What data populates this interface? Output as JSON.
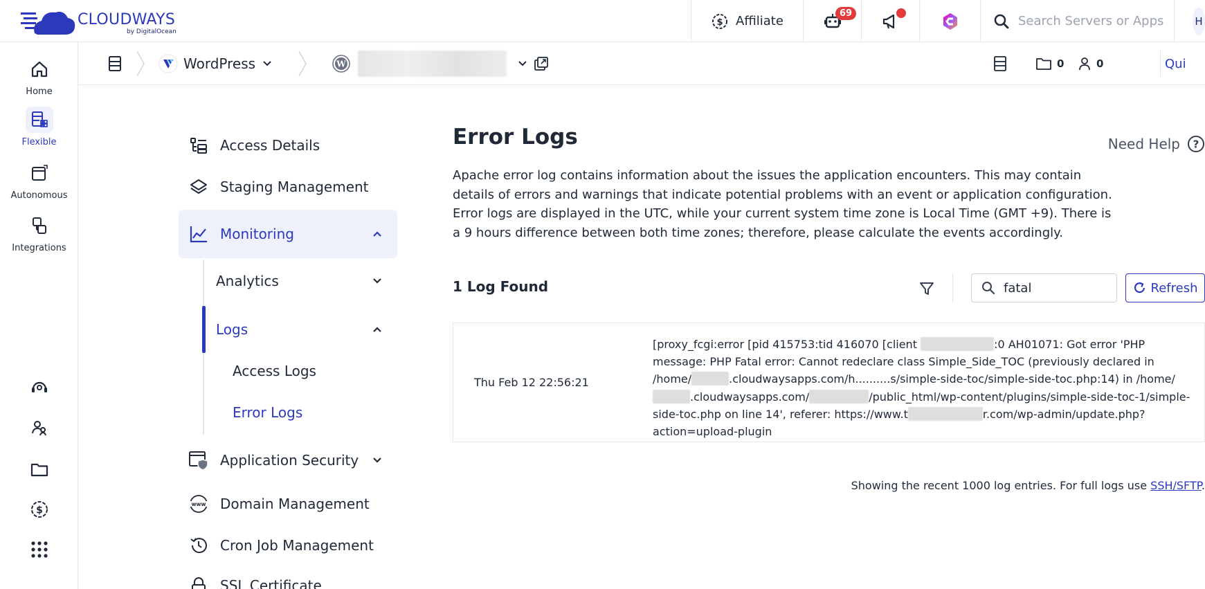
{
  "brand": {
    "name": "CLOUDWAYS",
    "sub": "by DigitalOcean",
    "accent": "#2c39bd",
    "badge_color": "#e23b3b"
  },
  "topbar": {
    "affiliate_label": "Affiliate",
    "bot_badge": "69",
    "search_placeholder": "Search Servers or Apps",
    "avatar_initial": "H"
  },
  "rail": {
    "items": [
      {
        "label": "Home",
        "icon": "home-icon"
      },
      {
        "label": "Flexible",
        "icon": "flexible-icon"
      },
      {
        "label": "Autonomous",
        "icon": "autonomous-icon"
      },
      {
        "label": "Integrations",
        "icon": "integrations-icon"
      }
    ],
    "bottom_icons": [
      "support-icon",
      "team-icon",
      "folder-icon",
      "billing-icon",
      "apps-grid-icon"
    ]
  },
  "breadcrumb": {
    "app_type": "WordPress",
    "stats": {
      "projects": "0",
      "members": "0"
    },
    "quick_label": "Qui"
  },
  "sidenav": {
    "items": [
      {
        "label": "Access Details"
      },
      {
        "label": "Staging Management"
      },
      {
        "label": "Monitoring"
      },
      {
        "label": "Analytics"
      },
      {
        "label": "Logs"
      },
      {
        "label": "Access Logs"
      },
      {
        "label": "Error Logs"
      },
      {
        "label": "Application Security"
      },
      {
        "label": "Domain Management"
      },
      {
        "label": "Cron Job Management"
      },
      {
        "label": "SSL Certificate"
      }
    ]
  },
  "main": {
    "title": "Error Logs",
    "need_help": "Need Help",
    "desc_1": "Apache error log contains information about the issues the application encounters. This may contain details of errors and warnings that indicate potential problems with an event or application configuration.",
    "desc_2": "Error logs are displayed in the UTC, while your current system time zone is Local Time (GMT +9). There is a 9 hours difference between both time zones; therefore, please calculate the events accordingly.",
    "log_count": "1 Log Found",
    "search_value": "fatal",
    "refresh_label": "Refresh",
    "logs": [
      {
        "time": "Thu Feb 12 22:56:21",
        "msg_1": "[proxy_fcgi:error [pid 415753:tid 416070 [client ",
        "msg_2": ":0 AH01071: Got error 'PHP message: PHP Fatal error: Cannot redeclare class Simple_Side_TOC (previously declared in /home/",
        "msg_3": ".cloudwaysapps.com/h..........s/simple-side-toc/simple-side-toc.php:14) in /home/",
        "msg_4": ".cloudwaysapps.com/",
        "msg_5": "/public_html/wp-content/plugins/simple-side-toc-1/simple-side-toc.php on line 14', referer: https://www.t",
        "msg_6": "r.com/wp-admin/update.php?action=upload-plugin"
      }
    ],
    "footer_text": "Showing the recent 1000 log entries. For full logs use ",
    "footer_link": "SSH/SFTP",
    "footer_end": "."
  }
}
